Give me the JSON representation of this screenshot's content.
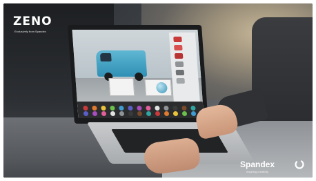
{
  "brand": {
    "zeno_logo": "ZENO",
    "zeno_tagline": "Exclusively from Spandex",
    "spandex_logo": "Spandex",
    "spandex_tagline": "Inspiring creativity",
    "spandex_mark_icon": "spandex-swirl-icon"
  },
  "screen": {
    "subject": "blue van",
    "swatch_colors": [
      "#c93a3a",
      "#e07a2e",
      "#e9c33a",
      "#6bbf4b",
      "#3f9bd0",
      "#5a5fc7",
      "#a84cc0",
      "#e25f9b",
      "#e2e2e2",
      "#8f9396",
      "#3a3a3a",
      "#7a4a2c",
      "#2fa6a0"
    ]
  }
}
